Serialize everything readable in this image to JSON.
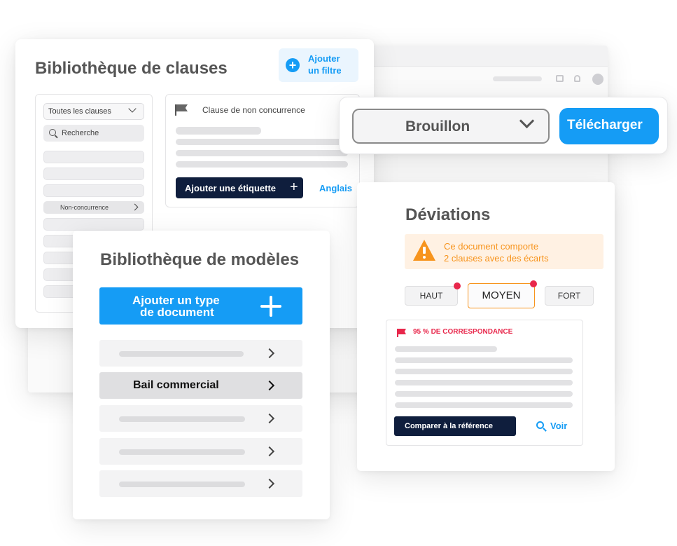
{
  "clause_library": {
    "title": "Bibliothèque de clauses",
    "add_filter_line1": "Ajouter",
    "add_filter_line2": "un filtre",
    "filter_select": "Toutes les clauses",
    "search_placeholder": "Recherche",
    "selected_item": "Non-concurrence",
    "clause_title": "Clause de non concurrence",
    "add_tag_button": "Ajouter une étiquette",
    "language_link": "Anglais"
  },
  "status_bar": {
    "status_select": "Brouillon",
    "download_button": "Télécharger"
  },
  "template_library": {
    "title": "Bibliothèque de modèles",
    "add_type_line1": "Ajouter un type",
    "add_type_line2": "de document",
    "selected_item": "Bail commercial"
  },
  "deviations": {
    "title": "Déviations",
    "warning_line1": "Ce document comporte",
    "warning_line2": "2 clauses avec des écarts",
    "levels": [
      "HAUT",
      "MOYEN",
      "FORT"
    ],
    "active_level": "MOYEN",
    "match_label": "95 % DE CORRESPONDANCE",
    "compare_button": "Comparer à la référence",
    "view_link": "Voir"
  },
  "colors": {
    "accent_blue": "#159cf5",
    "navy": "#0f1e3d",
    "warning_orange": "#f7941d",
    "alert_red": "#e8274b"
  }
}
